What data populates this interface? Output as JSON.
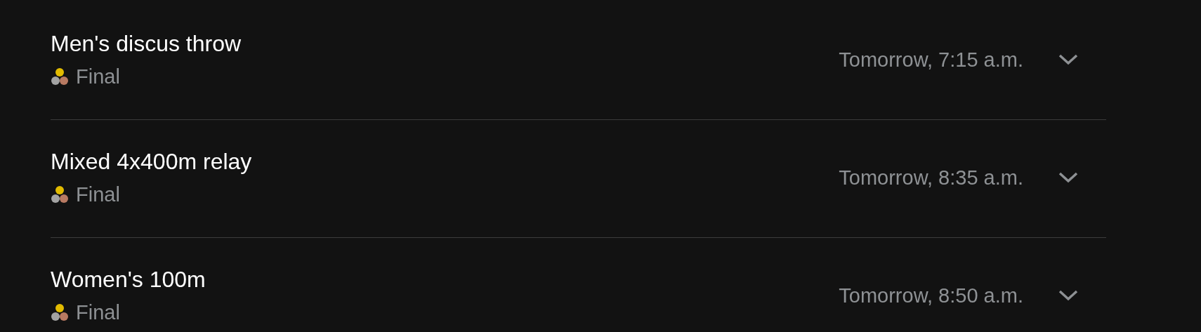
{
  "events": [
    {
      "title": "Men's discus throw",
      "round": "Final",
      "time": "Tomorrow, 7:15 a.m.",
      "expanded": false
    },
    {
      "title": "Mixed 4x400m relay",
      "round": "Final",
      "time": "Tomorrow, 8:35 a.m.",
      "expanded": false
    },
    {
      "title": "Women's 100m",
      "round": "Final",
      "time": "Tomorrow, 8:50 a.m.",
      "expanded": false
    }
  ]
}
